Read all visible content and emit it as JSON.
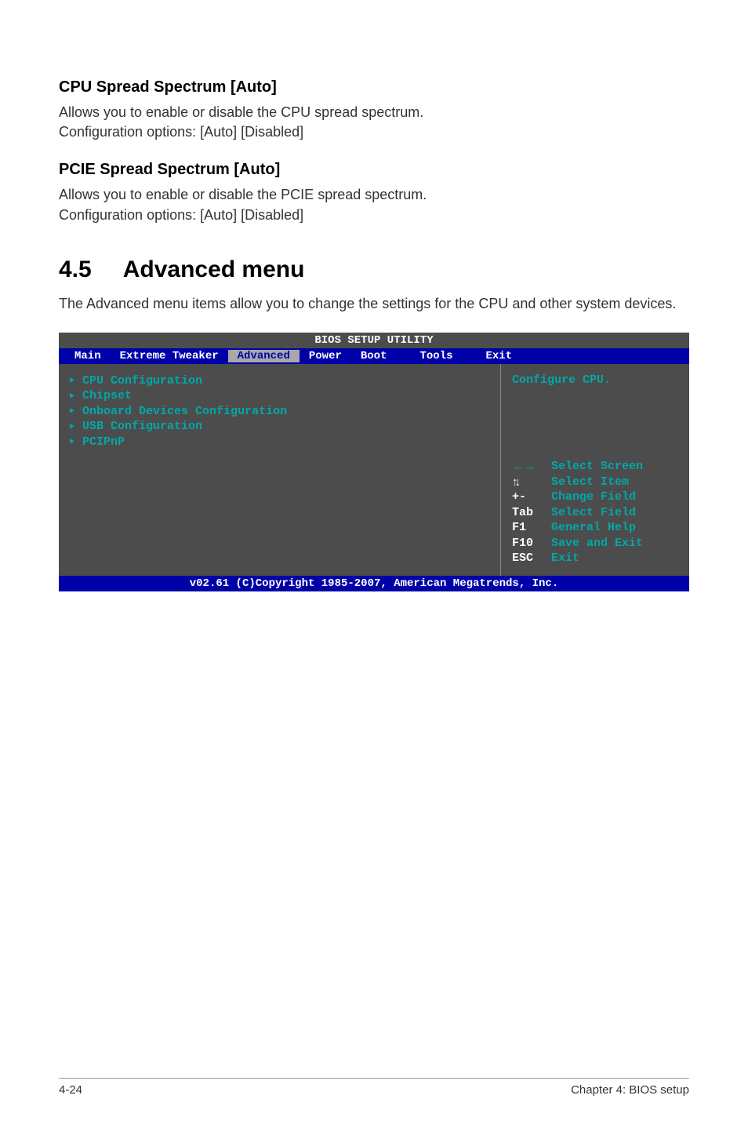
{
  "section1": {
    "heading": "CPU Spread Spectrum [Auto]",
    "line1": "Allows you to enable or disable the CPU spread spectrum.",
    "line2": "Configuration options: [Auto] [Disabled]"
  },
  "section2": {
    "heading": "PCIE Spread Spectrum [Auto]",
    "line1": "Allows you to enable or disable the PCIE spread spectrum.",
    "line2": "Configuration options: [Auto] [Disabled]"
  },
  "main": {
    "number": "4.5",
    "title": "Advanced menu",
    "intro": "The Advanced menu items allow you to change the settings for the CPU and other system devices."
  },
  "bios": {
    "title": "BIOS SETUP UTILITY",
    "menu": {
      "main": "Main",
      "extreme": "Extreme Tweaker",
      "advanced": "Advanced",
      "power": "Power",
      "boot": "Boot",
      "tools": "Tools",
      "exit": "Exit"
    },
    "items": {
      "cpu": "CPU Configuration",
      "chipset": "Chipset",
      "onboard": "Onboard Devices Configuration",
      "usb": "USB Configuration",
      "pcipnp": "PCIPnP"
    },
    "help": "Configure CPU.",
    "legend": {
      "lr": "Select Screen",
      "ud": "Select Item",
      "pm": "Change Field",
      "tab": "Select Field",
      "f1": "General Help",
      "f10": "Save and Exit",
      "esc": "Exit"
    },
    "legend_keys": {
      "lr": "←→",
      "ud": "↑↓",
      "pm": "+-",
      "tab": "Tab",
      "f1": "F1",
      "f10": "F10",
      "esc": "ESC"
    },
    "footer": "v02.61 (C)Copyright 1985-2007, American Megatrends, Inc."
  },
  "footer": {
    "left": "4-24",
    "right": "Chapter 4: BIOS setup"
  }
}
